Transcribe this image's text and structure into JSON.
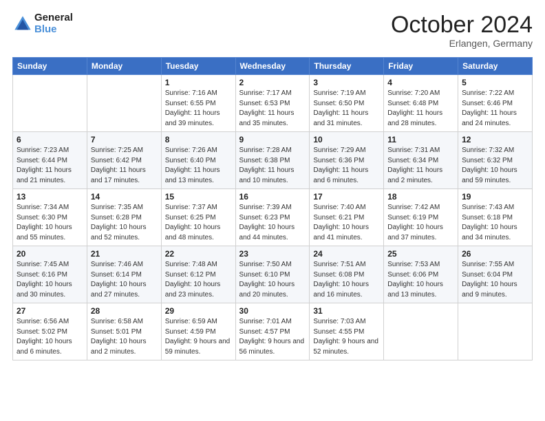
{
  "header": {
    "logo_line1": "General",
    "logo_line2": "Blue",
    "month_title": "October 2024",
    "subtitle": "Erlangen, Germany"
  },
  "weekdays": [
    "Sunday",
    "Monday",
    "Tuesday",
    "Wednesday",
    "Thursday",
    "Friday",
    "Saturday"
  ],
  "weeks": [
    [
      null,
      null,
      {
        "day": "1",
        "sunrise": "Sunrise: 7:16 AM",
        "sunset": "Sunset: 6:55 PM",
        "daylight": "Daylight: 11 hours and 39 minutes."
      },
      {
        "day": "2",
        "sunrise": "Sunrise: 7:17 AM",
        "sunset": "Sunset: 6:53 PM",
        "daylight": "Daylight: 11 hours and 35 minutes."
      },
      {
        "day": "3",
        "sunrise": "Sunrise: 7:19 AM",
        "sunset": "Sunset: 6:50 PM",
        "daylight": "Daylight: 11 hours and 31 minutes."
      },
      {
        "day": "4",
        "sunrise": "Sunrise: 7:20 AM",
        "sunset": "Sunset: 6:48 PM",
        "daylight": "Daylight: 11 hours and 28 minutes."
      },
      {
        "day": "5",
        "sunrise": "Sunrise: 7:22 AM",
        "sunset": "Sunset: 6:46 PM",
        "daylight": "Daylight: 11 hours and 24 minutes."
      }
    ],
    [
      {
        "day": "6",
        "sunrise": "Sunrise: 7:23 AM",
        "sunset": "Sunset: 6:44 PM",
        "daylight": "Daylight: 11 hours and 21 minutes."
      },
      {
        "day": "7",
        "sunrise": "Sunrise: 7:25 AM",
        "sunset": "Sunset: 6:42 PM",
        "daylight": "Daylight: 11 hours and 17 minutes."
      },
      {
        "day": "8",
        "sunrise": "Sunrise: 7:26 AM",
        "sunset": "Sunset: 6:40 PM",
        "daylight": "Daylight: 11 hours and 13 minutes."
      },
      {
        "day": "9",
        "sunrise": "Sunrise: 7:28 AM",
        "sunset": "Sunset: 6:38 PM",
        "daylight": "Daylight: 11 hours and 10 minutes."
      },
      {
        "day": "10",
        "sunrise": "Sunrise: 7:29 AM",
        "sunset": "Sunset: 6:36 PM",
        "daylight": "Daylight: 11 hours and 6 minutes."
      },
      {
        "day": "11",
        "sunrise": "Sunrise: 7:31 AM",
        "sunset": "Sunset: 6:34 PM",
        "daylight": "Daylight: 11 hours and 2 minutes."
      },
      {
        "day": "12",
        "sunrise": "Sunrise: 7:32 AM",
        "sunset": "Sunset: 6:32 PM",
        "daylight": "Daylight: 10 hours and 59 minutes."
      }
    ],
    [
      {
        "day": "13",
        "sunrise": "Sunrise: 7:34 AM",
        "sunset": "Sunset: 6:30 PM",
        "daylight": "Daylight: 10 hours and 55 minutes."
      },
      {
        "day": "14",
        "sunrise": "Sunrise: 7:35 AM",
        "sunset": "Sunset: 6:28 PM",
        "daylight": "Daylight: 10 hours and 52 minutes."
      },
      {
        "day": "15",
        "sunrise": "Sunrise: 7:37 AM",
        "sunset": "Sunset: 6:25 PM",
        "daylight": "Daylight: 10 hours and 48 minutes."
      },
      {
        "day": "16",
        "sunrise": "Sunrise: 7:39 AM",
        "sunset": "Sunset: 6:23 PM",
        "daylight": "Daylight: 10 hours and 44 minutes."
      },
      {
        "day": "17",
        "sunrise": "Sunrise: 7:40 AM",
        "sunset": "Sunset: 6:21 PM",
        "daylight": "Daylight: 10 hours and 41 minutes."
      },
      {
        "day": "18",
        "sunrise": "Sunrise: 7:42 AM",
        "sunset": "Sunset: 6:19 PM",
        "daylight": "Daylight: 10 hours and 37 minutes."
      },
      {
        "day": "19",
        "sunrise": "Sunrise: 7:43 AM",
        "sunset": "Sunset: 6:18 PM",
        "daylight": "Daylight: 10 hours and 34 minutes."
      }
    ],
    [
      {
        "day": "20",
        "sunrise": "Sunrise: 7:45 AM",
        "sunset": "Sunset: 6:16 PM",
        "daylight": "Daylight: 10 hours and 30 minutes."
      },
      {
        "day": "21",
        "sunrise": "Sunrise: 7:46 AM",
        "sunset": "Sunset: 6:14 PM",
        "daylight": "Daylight: 10 hours and 27 minutes."
      },
      {
        "day": "22",
        "sunrise": "Sunrise: 7:48 AM",
        "sunset": "Sunset: 6:12 PM",
        "daylight": "Daylight: 10 hours and 23 minutes."
      },
      {
        "day": "23",
        "sunrise": "Sunrise: 7:50 AM",
        "sunset": "Sunset: 6:10 PM",
        "daylight": "Daylight: 10 hours and 20 minutes."
      },
      {
        "day": "24",
        "sunrise": "Sunrise: 7:51 AM",
        "sunset": "Sunset: 6:08 PM",
        "daylight": "Daylight: 10 hours and 16 minutes."
      },
      {
        "day": "25",
        "sunrise": "Sunrise: 7:53 AM",
        "sunset": "Sunset: 6:06 PM",
        "daylight": "Daylight: 10 hours and 13 minutes."
      },
      {
        "day": "26",
        "sunrise": "Sunrise: 7:55 AM",
        "sunset": "Sunset: 6:04 PM",
        "daylight": "Daylight: 10 hours and 9 minutes."
      }
    ],
    [
      {
        "day": "27",
        "sunrise": "Sunrise: 6:56 AM",
        "sunset": "Sunset: 5:02 PM",
        "daylight": "Daylight: 10 hours and 6 minutes."
      },
      {
        "day": "28",
        "sunrise": "Sunrise: 6:58 AM",
        "sunset": "Sunset: 5:01 PM",
        "daylight": "Daylight: 10 hours and 2 minutes."
      },
      {
        "day": "29",
        "sunrise": "Sunrise: 6:59 AM",
        "sunset": "Sunset: 4:59 PM",
        "daylight": "Daylight: 9 hours and 59 minutes."
      },
      {
        "day": "30",
        "sunrise": "Sunrise: 7:01 AM",
        "sunset": "Sunset: 4:57 PM",
        "daylight": "Daylight: 9 hours and 56 minutes."
      },
      {
        "day": "31",
        "sunrise": "Sunrise: 7:03 AM",
        "sunset": "Sunset: 4:55 PM",
        "daylight": "Daylight: 9 hours and 52 minutes."
      },
      null,
      null
    ]
  ]
}
